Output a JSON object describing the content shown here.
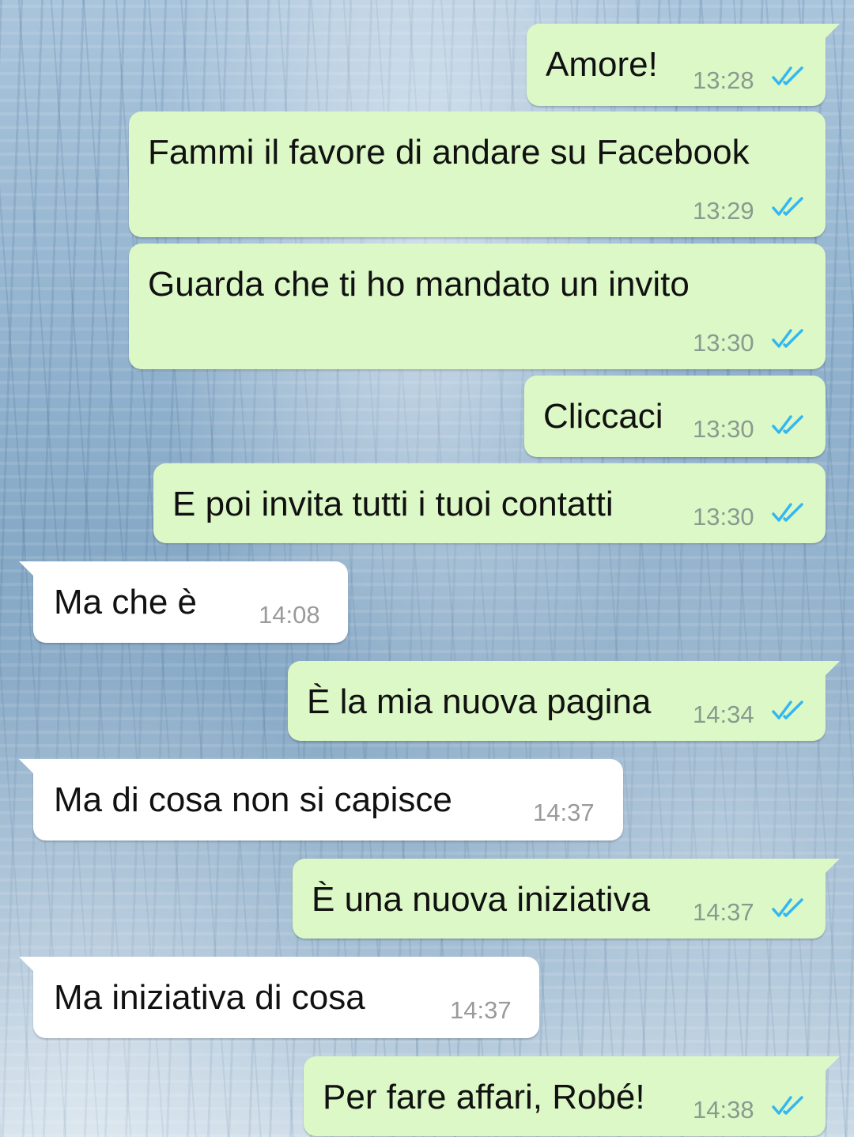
{
  "theme": {
    "outgoing_bubble": "#dcf8c6",
    "incoming_bubble": "#ffffff",
    "read_ticks_color": "#34b7f1"
  },
  "messages": [
    {
      "direction": "outgoing",
      "text": "Amore!",
      "time": "13:28",
      "status": "read-double-check-icon"
    },
    {
      "direction": "outgoing",
      "text": "Fammi il favore di andare su Facebook",
      "time": "13:29",
      "status": "read-double-check-icon"
    },
    {
      "direction": "outgoing",
      "text": "Guarda che ti ho mandato un invito",
      "time": "13:30",
      "status": "read-double-check-icon"
    },
    {
      "direction": "outgoing",
      "text": "Cliccaci",
      "time": "13:30",
      "status": "read-double-check-icon"
    },
    {
      "direction": "outgoing",
      "text": "E poi invita tutti i tuoi contatti",
      "time": "13:30",
      "status": "read-double-check-icon"
    },
    {
      "direction": "incoming",
      "text": "Ma che è",
      "time": "14:08"
    },
    {
      "direction": "outgoing",
      "text": "È la mia nuova pagina",
      "time": "14:34",
      "status": "read-double-check-icon"
    },
    {
      "direction": "incoming",
      "text": "Ma di cosa non si capisce",
      "time": "14:37"
    },
    {
      "direction": "outgoing",
      "text": "È una nuova iniziativa",
      "time": "14:37",
      "status": "read-double-check-icon"
    },
    {
      "direction": "incoming",
      "text": "Ma iniziativa di cosa",
      "time": "14:37"
    },
    {
      "direction": "outgoing",
      "text": "Per fare affari, Robé!",
      "time": "14:38",
      "status": "read-double-check-icon"
    }
  ]
}
